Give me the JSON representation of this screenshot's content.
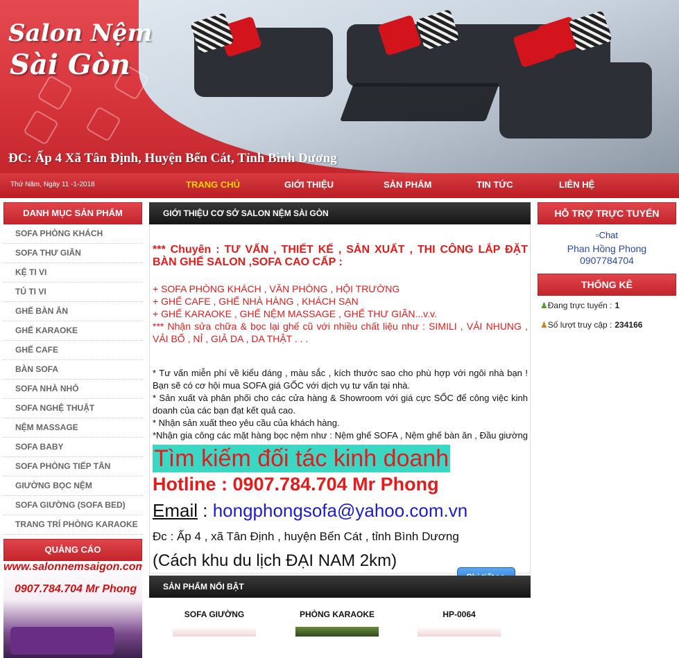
{
  "header": {
    "logo_line1": "Salon Nệm",
    "logo_line2": "Sài Gòn",
    "address": "ĐC: Ấp 4 Xã Tân Định, Huyện Bến Cát, Tỉnh Bình Dương"
  },
  "nav": {
    "date": "Thứ Năm, Ngày 11 -1-2018",
    "items": [
      {
        "label": "TRANG CHỦ"
      },
      {
        "label": "GIỚI THIỆU"
      },
      {
        "label": "SẢN PHẨM"
      },
      {
        "label": "TIN TỨC"
      },
      {
        "label": "LIÊN HỆ"
      }
    ]
  },
  "left": {
    "title": "DANH MỤC SẢN PHẨM",
    "items": [
      "SOFA PHÒNG KHÁCH",
      "SOFA THƯ GIÃN",
      "KỆ TI VI",
      "TỦ TI VI",
      "GHẾ BÀN ĂN",
      "GHẾ KARAOKE",
      "GHẾ CAFE",
      "BÀN SOFA",
      "SOFA NHÀ NHỎ",
      "SOFA NGHỆ THUẬT",
      "NỆM MASSAGE",
      "SOFA BABY",
      "SOFA PHÒNG TIẾP TÂN",
      "GIƯỜNG BỌC NỆM",
      "SOFA GIƯỜNG (SOFA BED)",
      "TRANG TRÍ PHÒNG KARAOKE"
    ],
    "ad_title": "QUẢNG CÁO",
    "ad_text1": "www.salonnemsaigon.com",
    "ad_text2": "0907.784.704 Mr Phong"
  },
  "main": {
    "title": "GIỚI THIỆU CƠ SỞ SALON NỆM SÀI GÒN",
    "headline": "*** Chuyên : TƯ VẤN , THIẾT KẾ , SẢN XUẤT , THI CÔNG LẮP ĐẶT BÀN GHẾ SALON ,SOFA CAO CẤP :",
    "red_lines": [
      "+ SOFA PHÒNG KHÁCH , VĂN PHÒNG , HỘI TRƯỜNG",
      "+ GHẾ CAFE , GHẾ NHÀ HÀNG , KHÁCH SẠN",
      "+ GHẾ KARAOKE , GHẾ NỆM MASSAGE , GHẾ THƯ GIÃN...v.v.",
      "*** Nhận sửa chữa & bọc lại ghế cũ với nhiều chất liệu như : SIMILI , VẢI NHUNG , VẢI BỐ , NỈ , GIẢ DA , DA THẬT . . ."
    ],
    "black_lines": [
      "* Tư vấn miễn phí về kiểu dáng , màu sắc , kích thước sao cho phù hợp với ngôi nhà bạn ! Bạn sẽ có cơ hội mua SOFA giá GỐC với dịch vụ tư vấn tại nhà.",
      "* Sản xuất và phân phối cho các cửa hàng & Showroom với giá cực SỐC để công việc kinh doanh của các bạn đạt kết quả cao.",
      "* Nhận sản xuất theo yêu cầu của khách hàng.",
      "*Nhận gia công các mặt hàng bọc nệm như : Nệm ghế SOFA , Nệm ghế bàn ăn , Đầu giường , Vách ốp tường..."
    ],
    "partner": "Tìm kiếm đối tác kinh doanh",
    "hotline": "Hotline : 0907.784.704 Mr Phong",
    "email_label": "Email",
    "email_sep": " : ",
    "email": "hongphongsofa@yahoo.com.vn",
    "addr": "Đc : Ấp 4 , xã Tân Định , huyện Bến Cát , tỉnh Bình Dương",
    "distance": "(Cách khu du lịch ĐẠI NAM 2km)",
    "detail_button": "Chi tiết >>"
  },
  "featured": {
    "title": "SẢN PHẨM NỔI BẬT",
    "products": [
      {
        "name": "SOFA GIƯỜNG"
      },
      {
        "name": "PHÒNG KARAOKE"
      },
      {
        "name": "HP-0064"
      }
    ]
  },
  "right": {
    "support_title": "HỖ TRỢ TRỰC TUYẾN",
    "chat_alt": "Chat",
    "contact_name": "Phan Hồng Phong",
    "contact_phone": "0907784704",
    "stats_title": "THỐNG KÊ",
    "online_label": "Đang trực tuyến :",
    "online_value": "1",
    "visits_label": "Số lượt truy cập :",
    "visits_value": "234166"
  },
  "colors": {
    "brand_red": "#d6343b",
    "nav_active": "#ffd200",
    "highlight": "#3cd6c4",
    "link_blue": "#1c1ccc"
  }
}
